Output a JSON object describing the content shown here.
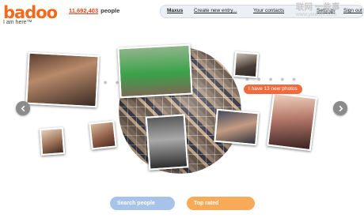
{
  "brand": {
    "logo": "badoo",
    "tagline": "I am here™"
  },
  "counter": {
    "number": "11,692,403",
    "suffix": "people"
  },
  "topbar": {
    "user": "Maxus",
    "create": "Create new entry...",
    "contacts": "Your contacts",
    "settings": "Settings",
    "signout": "Sign out"
  },
  "watermark": {
    "title": "联网 一些事",
    "url": "www.yixieshi.com"
  },
  "tooltip": "I have 13 new photos",
  "buttons": {
    "search": "Search people",
    "top": "Top rated"
  },
  "dots": {
    "left": "•  •  •",
    "right": "•  •  •  •  •"
  },
  "icons": {
    "prev": "arrow-left",
    "next": "arrow-right"
  }
}
